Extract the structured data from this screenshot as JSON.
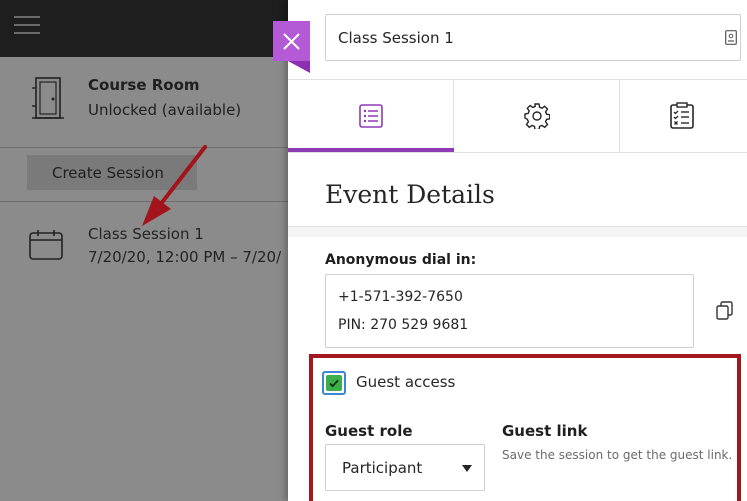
{
  "left_panel": {
    "course_room": {
      "title": "Course Room",
      "status": "Unlocked (available)",
      "icon": "door-icon"
    },
    "create_session_label": "Create Session",
    "session": {
      "name": "Class Session 1",
      "time": "7/20/20, 12:00 PM – 7/20/",
      "icon": "calendar-icon"
    }
  },
  "editor": {
    "title_value": "Class Session 1",
    "tabs": [
      {
        "name": "event-details",
        "icon": "list-icon",
        "active": true
      },
      {
        "name": "session-settings",
        "icon": "gear-icon",
        "active": false
      },
      {
        "name": "attendance",
        "icon": "clipboard-icon",
        "active": false
      }
    ],
    "heading": "Event Details",
    "dial_in": {
      "label": "Anonymous dial in:",
      "number": "+1-571-392-7650",
      "pin": "PIN: 270 529 9681"
    },
    "guest": {
      "access_label": "Guest access",
      "access_checked": true,
      "role_label": "Guest role",
      "role_value": "Participant",
      "link_label": "Guest link",
      "link_note": "Save the session to get the guest link."
    }
  },
  "colors": {
    "accent": "#8e3bb5",
    "close_button": "#b45ad6",
    "highlight_frame": "#a4171e",
    "checkbox_fill": "#3cae4a",
    "arrow": "#a3141c"
  }
}
